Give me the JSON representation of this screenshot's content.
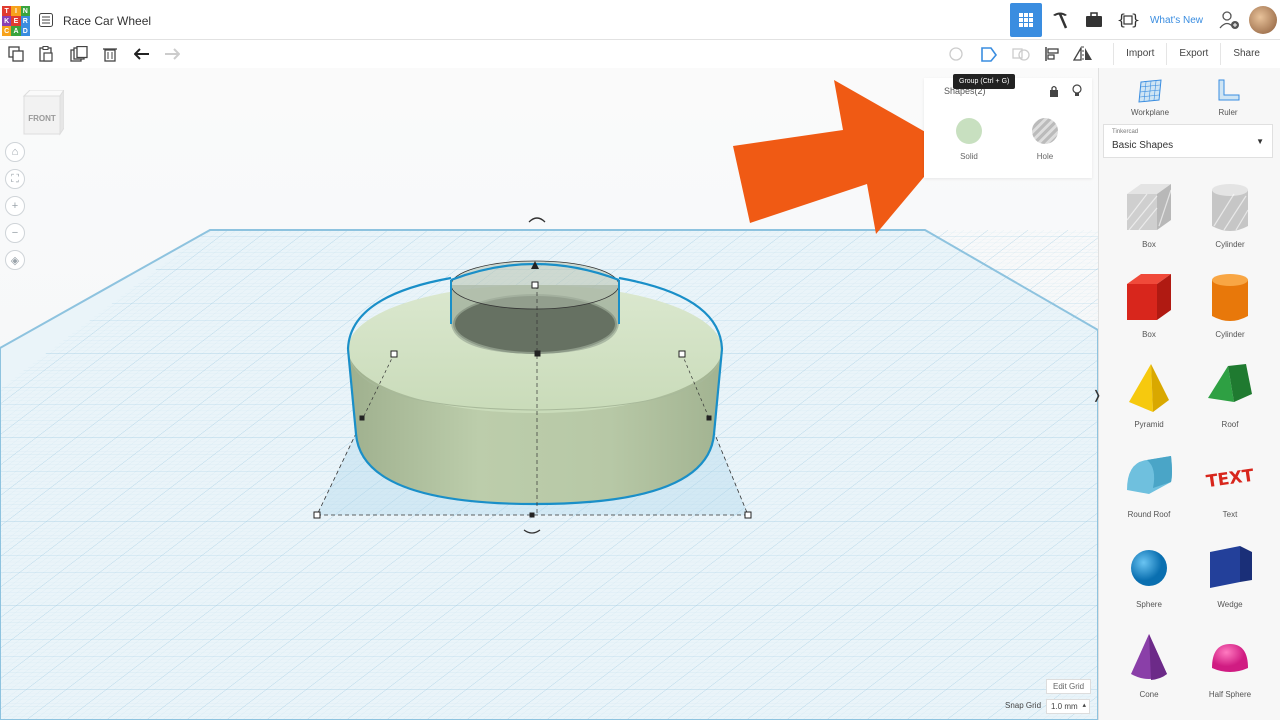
{
  "header": {
    "logo_letters": [
      "T",
      "I",
      "N",
      "K",
      "E",
      "R",
      "C",
      "A",
      "D"
    ],
    "logo_colors": [
      "#e03b2f",
      "#f7a21b",
      "#3aa43e",
      "#8a3fb2",
      "#e03b2f",
      "#3a8de0",
      "#f7a21b",
      "#3aa43e",
      "#3a8de0"
    ],
    "title": "Race Car Wheel",
    "whats_new": "What's New"
  },
  "toolbar": {
    "import": "Import",
    "export": "Export",
    "share": "Share",
    "tooltip": "Group (Ctrl + G)"
  },
  "viewcube": {
    "label": "FRONT"
  },
  "inspector": {
    "title": "Shapes(2)",
    "solid": "Solid",
    "hole": "Hole"
  },
  "panel": {
    "workplane": "Workplane",
    "ruler": "Ruler",
    "library_small": "Tinkercad",
    "library_name": "Basic Shapes",
    "shapes": [
      {
        "label": "Box",
        "icon": "box-hole-icon"
      },
      {
        "label": "Cylinder",
        "icon": "cylinder-hole-icon"
      },
      {
        "label": "Box",
        "icon": "box-icon"
      },
      {
        "label": "Cylinder",
        "icon": "cylinder-icon"
      },
      {
        "label": "Pyramid",
        "icon": "pyramid-icon"
      },
      {
        "label": "Roof",
        "icon": "roof-icon"
      },
      {
        "label": "Round Roof",
        "icon": "round-roof-icon"
      },
      {
        "label": "Text",
        "icon": "text-icon"
      },
      {
        "label": "Sphere",
        "icon": "sphere-icon"
      },
      {
        "label": "Wedge",
        "icon": "wedge-icon"
      },
      {
        "label": "Cone",
        "icon": "cone-icon"
      },
      {
        "label": "Half Sphere",
        "icon": "half-sphere-icon"
      }
    ],
    "text_shape_glyphs": "TEXT"
  },
  "grid": {
    "edit_grid": "Edit Grid",
    "snap_grid": "Snap Grid",
    "snap_value": "1.0 mm"
  },
  "colors": {
    "accent": "#3a8de0",
    "arrow": "#f05a14",
    "solid": "#c8e0c0",
    "wheel": "#c5d7b4",
    "selection": "#1a8fc8"
  }
}
